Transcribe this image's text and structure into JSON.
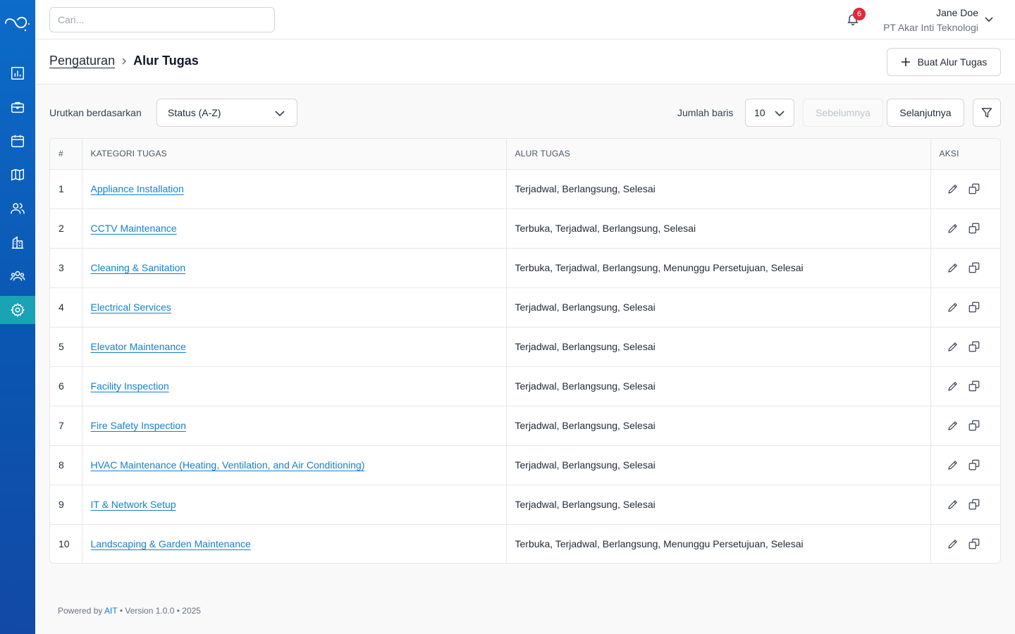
{
  "sidebar": {
    "items": [
      {
        "icon": "chart-icon"
      },
      {
        "icon": "briefcase-icon"
      },
      {
        "icon": "calendar-icon"
      },
      {
        "icon": "map-icon"
      },
      {
        "icon": "users-icon"
      },
      {
        "icon": "building-icon"
      },
      {
        "icon": "team-icon"
      },
      {
        "icon": "gear-icon",
        "active": true
      }
    ]
  },
  "topbar": {
    "search_placeholder": "Cari...",
    "notification_count": "6",
    "user_name": "Jane Doe",
    "user_company": "PT Akar Inti Teknologi"
  },
  "header": {
    "breadcrumb_parent": "Pengaturan",
    "title": "Alur Tugas",
    "create_button": "Buat Alur Tugas"
  },
  "controls": {
    "sort_label": "Urutkan berdasarkan",
    "sort_value": "Status (A-Z)",
    "rows_label": "Jumlah baris",
    "rows_value": "10",
    "prev_label": "Sebelumnya",
    "next_label": "Selanjutnya"
  },
  "table": {
    "headers": {
      "num": "#",
      "category": "KATEGORI TUGAS",
      "flow": "ALUR TUGAS",
      "actions": "AKSI"
    },
    "rows": [
      {
        "num": "1",
        "category": "Appliance Installation",
        "flow": "Terjadwal, Berlangsung, Selesai"
      },
      {
        "num": "2",
        "category": "CCTV Maintenance",
        "flow": "Terbuka, Terjadwal, Berlangsung, Selesai"
      },
      {
        "num": "3",
        "category": "Cleaning & Sanitation",
        "flow": "Terbuka, Terjadwal, Berlangsung, Menunggu Persetujuan, Selesai"
      },
      {
        "num": "4",
        "category": "Electrical Services",
        "flow": "Terjadwal, Berlangsung, Selesai"
      },
      {
        "num": "5",
        "category": "Elevator Maintenance",
        "flow": "Terjadwal, Berlangsung, Selesai"
      },
      {
        "num": "6",
        "category": "Facility Inspection",
        "flow": "Terjadwal, Berlangsung, Selesai"
      },
      {
        "num": "7",
        "category": "Fire Safety Inspection",
        "flow": "Terjadwal, Berlangsung, Selesai"
      },
      {
        "num": "8",
        "category": "HVAC Maintenance (Heating, Ventilation, and Air Conditioning)",
        "flow": "Terjadwal, Berlangsung, Selesai"
      },
      {
        "num": "9",
        "category": "IT & Network Setup",
        "flow": "Terjadwal, Berlangsung, Selesai"
      },
      {
        "num": "10",
        "category": "Landscaping & Garden Maintenance",
        "flow": "Terbuka, Terjadwal, Berlangsung, Menunggu Persetujuan, Selesai"
      }
    ]
  },
  "footer": {
    "prefix": "Powered by ",
    "brand": "AIT",
    "suffix": " • Version 1.0.0 • 2025"
  },
  "colors": {
    "sidebar": "#0a56b0",
    "active_nav": "#1aa3b5",
    "link": "#1380d0",
    "badge": "#dc2a3b"
  }
}
